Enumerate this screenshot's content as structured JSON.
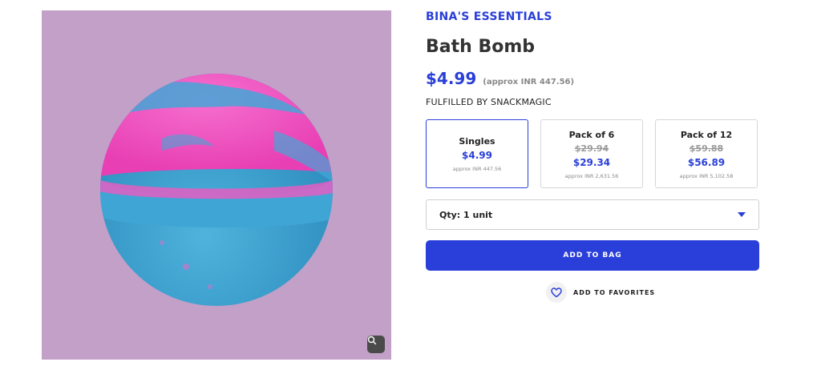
{
  "brand": "BINA'S ESSENTIALS",
  "product": {
    "title": "Bath Bomb",
    "price": "$4.99",
    "approx": "(approx INR 447.56)",
    "fulfilled": "FULFILLED BY SNACKMAGIC"
  },
  "options": [
    {
      "name": "Singles",
      "price": "$4.99",
      "approx": "approx INR 447.56",
      "selected": true
    },
    {
      "name": "Pack of 6",
      "old_price": "$29.94",
      "price": "$29.34",
      "approx": "approx INR 2,631.56",
      "selected": false
    },
    {
      "name": "Pack of 12",
      "old_price": "$59.88",
      "price": "$56.89",
      "approx": "approx INR 5,102.58",
      "selected": false
    }
  ],
  "quantity": {
    "label": "Qty: 1 unit"
  },
  "actions": {
    "add_to_bag": "ADD TO BAG",
    "add_to_favorites": "ADD TO FAVORITES"
  },
  "icons": {
    "zoom": "magnifier-icon",
    "favorite": "heart-icon",
    "dropdown": "caret-down-icon"
  },
  "colors": {
    "accent": "#2a3fd9",
    "image_background": "#c2a0c8"
  }
}
